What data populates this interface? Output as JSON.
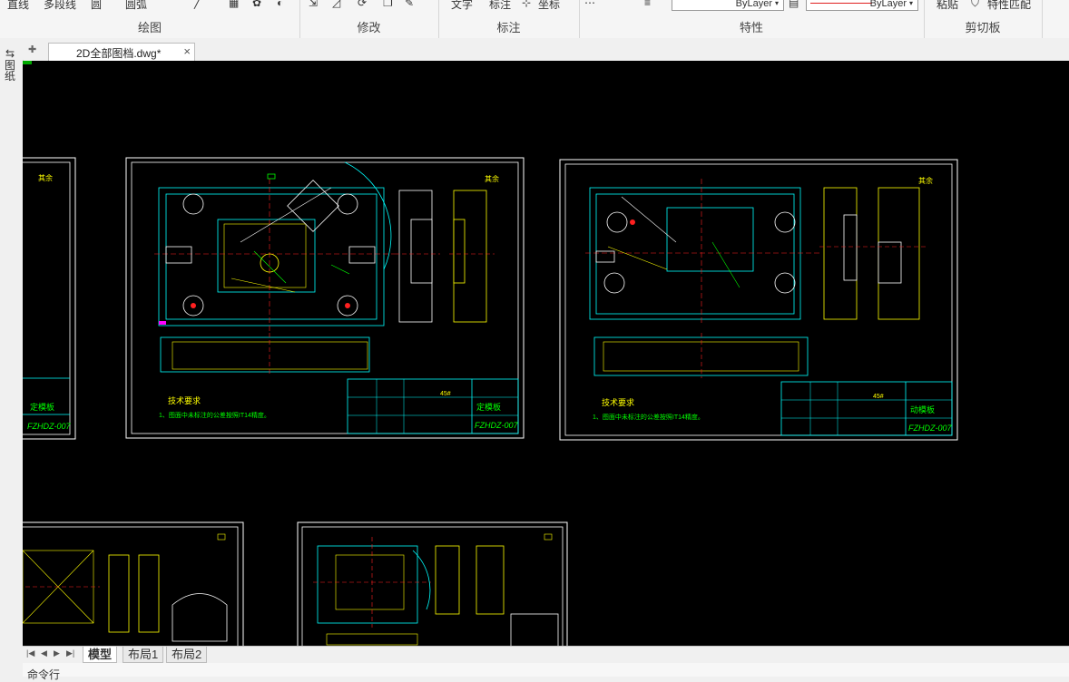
{
  "ribbon": {
    "partial_labels": [
      "直线",
      "多段线",
      "圆",
      "圆弧"
    ],
    "groups": {
      "draw": "绘图",
      "modify": "修改",
      "annotate": "标注",
      "properties": "特性",
      "clipboard": "剪切板"
    },
    "annotate_items": [
      "文字",
      "标注",
      "坐标"
    ],
    "properties_items": [
      "特性匹配"
    ],
    "layer_combo_1": "ByLayer",
    "layer_combo_2": "ByLayer",
    "clipboard_items": [
      "粘贴",
      "特性匹配"
    ],
    "colors": {
      "linetype_red": "#e02020"
    }
  },
  "left_strip": {
    "label": "图纸"
  },
  "document_tab": {
    "name": "2D全部图档.dwg*",
    "close": "×"
  },
  "drawings": {
    "left_partial": {
      "part_name": "定模板",
      "code": "FZHDZ-007",
      "mark": "其余"
    },
    "sheet_1": {
      "tech_title": "技术要求",
      "tech_note": "1、图面中未标注的公差按照IT14精度。",
      "part_name": "定模板",
      "code": "FZHDZ-007",
      "mark": "其余",
      "material": "45#"
    },
    "sheet_2": {
      "tech_title": "技术要求",
      "tech_note": "1、图面中未标注的公差按照IT14精度。",
      "part_name": "动模板",
      "code": "FZHDZ-007",
      "mark": "其余",
      "material": "45#"
    }
  },
  "layout_tabs": {
    "nav": [
      "|◀",
      "◀",
      "▶",
      "▶|"
    ],
    "tabs": [
      "模型",
      "布局1",
      "布局2"
    ],
    "active": "模型"
  },
  "command_line": {
    "text": "命令行"
  },
  "canvas_colors": {
    "background": "#000000",
    "frame": "#ffffff",
    "cyan": "#00ffff",
    "yellow": "#ffff00",
    "red": "#ff2020",
    "green": "#00ff00",
    "magenta": "#ff00ff"
  }
}
